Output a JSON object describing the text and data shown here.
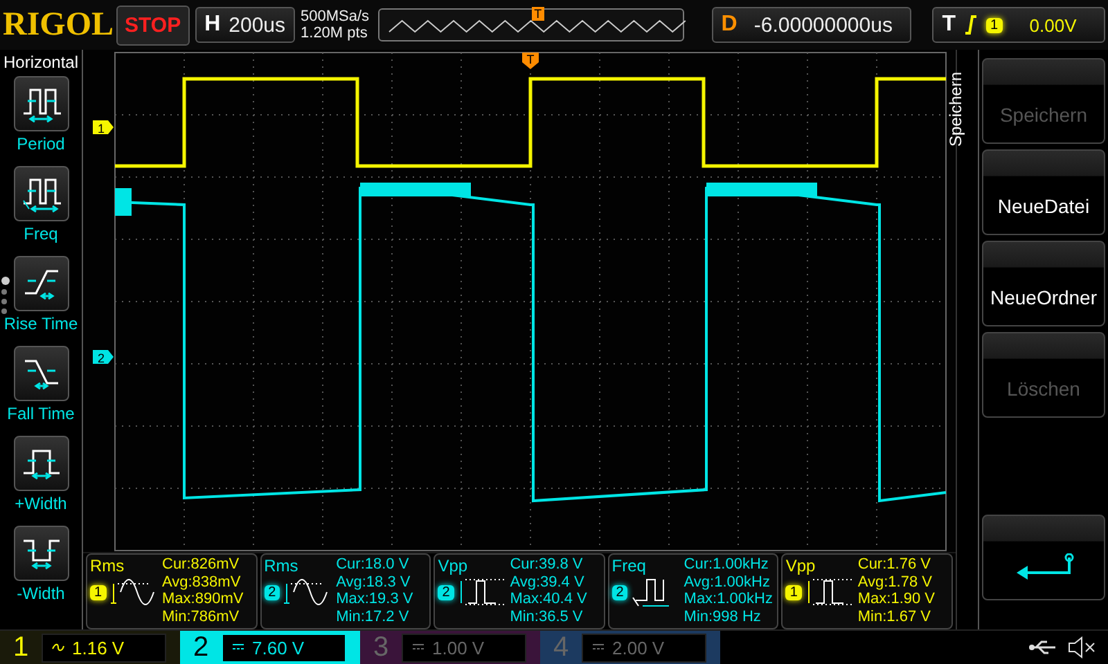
{
  "top_bar": {
    "logo": "RIGOL",
    "run_state": "STOP",
    "horizontal": {
      "label": "H",
      "timebase": "200us"
    },
    "sample_rate": "500MSa/s",
    "memory_depth": "1.20M pts",
    "trigger_position_label": "T",
    "delay": {
      "label": "D",
      "value": "-6.00000000us"
    },
    "trigger": {
      "label": "T",
      "source": "1",
      "level": "0.00V"
    }
  },
  "sidebar": {
    "title": "Horizontal",
    "items": [
      {
        "kind": "period",
        "label": "Period"
      },
      {
        "kind": "freq",
        "label": "Freq"
      },
      {
        "kind": "rise",
        "label": "Rise Time"
      },
      {
        "kind": "fall",
        "label": "Fall Time"
      },
      {
        "kind": "pwidth",
        "label": "+Width"
      },
      {
        "kind": "nwidth",
        "label": "-Width"
      }
    ],
    "pages": [
      {
        "selected": true
      },
      {
        "selected": false
      },
      {
        "selected": false
      },
      {
        "selected": false
      }
    ]
  },
  "scope": {
    "trigger_marker": "T",
    "channel_markers": [
      {
        "label": "1",
        "color": "#f5f500"
      },
      {
        "label": "2",
        "color": "#00e5e5"
      }
    ]
  },
  "measurements": [
    {
      "kind": "rms",
      "name": "Rms",
      "channel": "1",
      "color": "#f5f500",
      "cur": "Cur:826mV",
      "avg": "Avg:838mV",
      "max": "Max:890mV",
      "min": "Min:786mV"
    },
    {
      "kind": "rms",
      "name": "Rms",
      "channel": "2",
      "color": "#00e5e5",
      "cur": "Cur:18.0 V",
      "avg": "Avg:18.3 V",
      "max": "Max:19.3 V",
      "min": "Min:17.2 V"
    },
    {
      "kind": "vpp",
      "name": "Vpp",
      "channel": "2",
      "color": "#00e5e5",
      "cur": "Cur:39.8 V",
      "avg": "Avg:39.4 V",
      "max": "Max:40.4 V",
      "min": "Min:36.5 V"
    },
    {
      "kind": "freq",
      "name": "Freq",
      "channel": "2",
      "color": "#00e5e5",
      "cur": "Cur:1.00kHz",
      "avg": "Avg:1.00kHz",
      "max": "Max:1.00kHz",
      "min": "Min:998 Hz"
    },
    {
      "kind": "vpp",
      "name": "Vpp",
      "channel": "1",
      "color": "#f5f500",
      "cur": "Cur:1.76 V",
      "avg": "Avg:1.78 V",
      "max": "Max:1.90 V",
      "min": "Min:1.67 V"
    }
  ],
  "menu": {
    "title": "Speichern",
    "buttons": [
      {
        "kind": "text",
        "label": "Speichern",
        "disabled": true
      },
      {
        "kind": "text",
        "label": "NeueDatei",
        "disabled": false
      },
      {
        "kind": "text",
        "label": "NeueOrdner",
        "disabled": false
      },
      {
        "kind": "text",
        "label": "Löschen",
        "disabled": true
      },
      {
        "kind": "empty"
      },
      {
        "kind": "return"
      }
    ]
  },
  "channels": [
    {
      "number": "1",
      "kind": "ac",
      "scale": "1.16 V",
      "color": "#f5f500",
      "enabled": true,
      "selected": false
    },
    {
      "number": "2",
      "kind": "dc",
      "scale": "7.60 V",
      "color": "#00e5e5",
      "enabled": true,
      "selected": true
    },
    {
      "number": "3",
      "kind": "dc",
      "scale": "1.00 V",
      "color": "#3a143a",
      "enabled": false,
      "selected": false
    },
    {
      "number": "4",
      "kind": "dc",
      "scale": "2.00 V",
      "color": "#1c3a60",
      "enabled": false,
      "selected": false
    }
  ]
}
